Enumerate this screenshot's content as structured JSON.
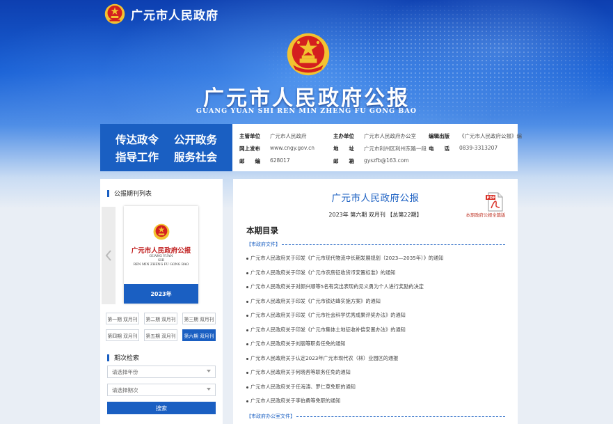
{
  "header": {
    "site_title": "广元市人民政府",
    "main_title": "广元市人民政府公报",
    "main_subtitle": "GUANG YUAN SHI REN MIN ZHENG FU GONG BAO"
  },
  "slogans": [
    "传达政令",
    "公开政务",
    "指导工作",
    "服务社会"
  ],
  "info": [
    {
      "k": "主管单位",
      "v": "广元市人民政府"
    },
    {
      "k": "主办单位",
      "v": "广元市人民政府办公室"
    },
    {
      "k": "编辑出版",
      "v": "《广元市人民政府公报》编"
    },
    {
      "k": "网上发布",
      "v": "www.cngy.gov.cn"
    },
    {
      "k": "地　　址",
      "v": "广元市利州区利州东路一段"
    },
    {
      "k": "电　　话",
      "v": "0839-3313207"
    },
    {
      "k": "邮　　编",
      "v": "628017"
    },
    {
      "k": "邮　　箱",
      "v": "gyszfb@163.com"
    }
  ],
  "sidebar": {
    "list_title": "公报期刊列表",
    "cover": {
      "title": "广元市人民政府公报",
      "subtitle_line1": "GUANG YUAN",
      "subtitle_line2": "SHI",
      "subtitle_line3": "REN MIN ZHENG FU GONG BAO",
      "year": "2023年"
    },
    "issues": [
      "第一期 双月刊",
      "第二期 双月刊",
      "第三期 双月刊",
      "第四期 双月刊",
      "第五期 双月刊",
      "第六期 双月刊"
    ],
    "active_issue": 5,
    "search_title": "期次检索",
    "select_year": "请选择年份",
    "select_issue": "请选择期次",
    "search_label": "搜索"
  },
  "main": {
    "title": "广元市人民政府公报",
    "issue_line": "2023年 第六期 双月刊 【总第22期】",
    "pdf_label": "本期政府公报全篇版",
    "toc_title": "本期目录",
    "category1": "【市政府文件】",
    "category2": "【市政府办公室文件】",
    "items": [
      "广元市人民政府关于印发《广元市现代物流中长期发展规划（2023—2035年）》的通知",
      "广元市人民政府关于印发《广元市农房征收货币安置标准》的通知",
      "广元市人民政府关于对颜兴顺等5名有突出表现的见义勇为个人进行奖励的决定",
      "广元市人民政府关于印发《广元市锁达峰实施方案》的通知",
      "广元市人民政府关于印发《广元市社会科学优秀成果评奖办法》的通知",
      "广元市人民政府关于印发《广元市集体土地征收补偿安置办法》的通知",
      "广元市人民政府关于刘丽等职务任免的通知",
      "广元市人民政府关于认定2023年广元市现代农（林）业园区的通报",
      "广元市人民政府关于何晓善等职务任免的通知",
      "广元市人民政府关于任海涛、罗仁草免职的通知",
      "广元市人民政府关于李伯勇等免职的通知"
    ]
  },
  "colors": {
    "primary": "#1a5fc2",
    "emblem_red": "#d41f1f",
    "emblem_gold": "#f2c230"
  }
}
